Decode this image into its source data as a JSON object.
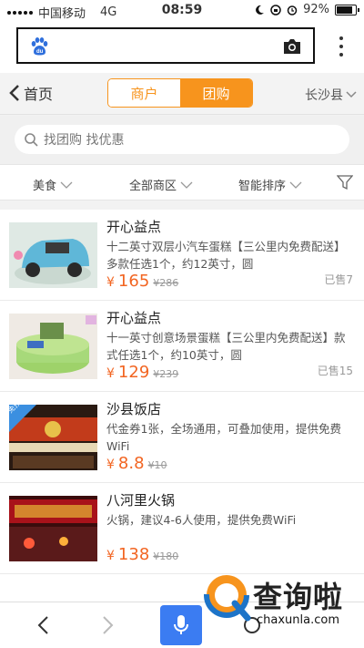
{
  "status_bar": {
    "carrier": "中国移动",
    "network": "4G",
    "time": "08:59",
    "battery_percent": "92%",
    "battery_level": 0.92
  },
  "browser": {
    "logo_icon": "baidu-paw-icon",
    "camera_icon": "camera-icon",
    "menu_icon": "kebab-menu-icon"
  },
  "nav": {
    "back_label": "首页",
    "tabs": [
      {
        "label": "商户",
        "active": false
      },
      {
        "label": "团购",
        "active": true
      }
    ],
    "city": "长沙县",
    "accent_color": "#f7941d"
  },
  "search": {
    "placeholder": "找团购 找优惠"
  },
  "filters": [
    {
      "label": "美食"
    },
    {
      "label": "全部商区"
    },
    {
      "label": "智能排序"
    }
  ],
  "deals": [
    {
      "title": "开心益点",
      "desc": "十二英寸双层小汽车蛋糕【三公里内免费配送】多款任选1个，约12英寸，圆",
      "yen": "¥",
      "price": "165",
      "orig": "¥286",
      "sold": "已售7"
    },
    {
      "title": "开心益点",
      "desc": "十一英寸创意场景蛋糕【三公里内免费配送】款式任选1个，约10英寸，圆",
      "yen": "¥",
      "price": "129",
      "orig": "¥239",
      "sold": "已售15"
    },
    {
      "title": "沙县饭店",
      "desc": "代金券1张，全场通用，可叠加使用，提供免费WiFi",
      "yen": "¥",
      "price": "8.8",
      "orig": "¥10",
      "sold": "",
      "badge": "免预约"
    },
    {
      "title": "八河里火锅",
      "desc": "火锅，建议4-6人使用，提供免费WiFi",
      "yen": "¥",
      "price": "138",
      "orig": "¥180",
      "sold": ""
    }
  ],
  "watermark": {
    "text": "查询啦",
    "url": "chaxunla.com"
  },
  "price_color": "#f26522",
  "mic_color": "#3b7cf2"
}
